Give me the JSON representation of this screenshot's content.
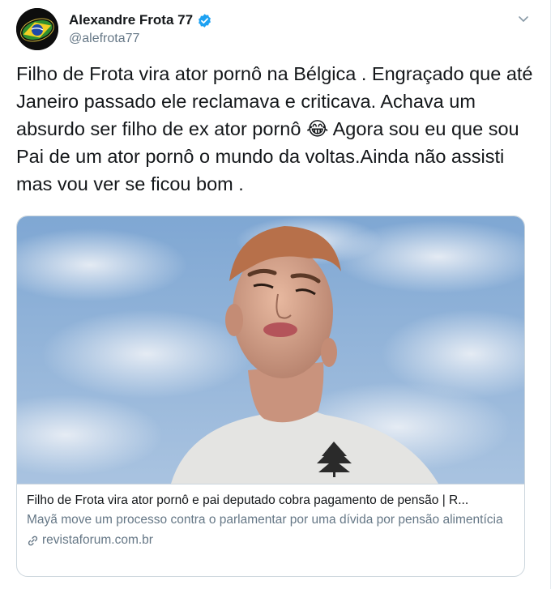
{
  "author": {
    "display_name": "Alexandre Frota 77",
    "handle": "@alefrota77",
    "verified": true,
    "avatar_icon": "avatar-flag-logo"
  },
  "tweet": {
    "text": "Filho de Frota vira ator pornô na Bélgica . Engraçado que até Janeiro passado ele reclamava e criticava. Achava um absurdo ser filho de ex ator pornô 😂 Agora sou eu que sou Pai de um ator pornô o mundo da voltas.Ainda não assisti mas vou ver se ficou bom ."
  },
  "card": {
    "title": "Filho de Frota vira ator pornô e pai deputado cobra pagamento de pensão | R...",
    "description": "Mayã move um processo contra o parlamentar por uma dívida por pensão alimentícia",
    "domain": "revistaforum.com.br",
    "domain_icon": "link-icon"
  },
  "colors": {
    "text": "#14171a",
    "secondary": "#657786",
    "verified": "#1da1f2",
    "border": "#ccd6dd",
    "sky": "#8fb3d9"
  }
}
